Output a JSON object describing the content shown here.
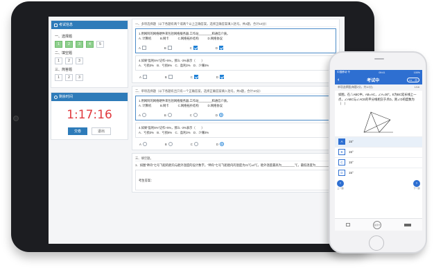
{
  "tablet": {
    "left_panel": {
      "nav_title": "考试信息",
      "sections": [
        {
          "title": "一、选择题",
          "numbers": [
            "1",
            "2",
            "3",
            "4",
            "5"
          ],
          "done": [
            true,
            true,
            true,
            true,
            false
          ]
        },
        {
          "title": "二、填空题",
          "numbers": [
            "1",
            "2",
            "3"
          ],
          "done": [
            false,
            false,
            false
          ]
        },
        {
          "title": "三、简答题",
          "numbers": [
            "1",
            "2",
            "3"
          ],
          "done": [
            false,
            false,
            false
          ]
        }
      ],
      "timer_title": "剩余时间",
      "timer": "1:17:16",
      "submit_label": "交卷",
      "exit_label": "退出"
    },
    "questions": {
      "section1_head": "一、多项选择题（以下各题有两个或两个以上正确答案，选择正确答案填入括号。共2题，合计10分）",
      "q1_text": "1.用网阿的网络硬件来包括网络服务器,工作站________和通信介质。",
      "q1_choices": "A. 计算机　　　B.网卡　　　C.网络拓扑结构　　　D.网络协议",
      "q2_text": "4.如果“盈利5%”记作+5%，那么 -3%表示（　　）",
      "q2_choices": "A．亏损3%　B．亏损8%　C．盈利2%　D．少赚3%",
      "section2_head": "二、单项选择题（以下各题有且只有一个正确答案，选择正确答案填入括号。共2题，合计10分）",
      "q3_text": "1.用网阿的网络硬件来包括网络服务器,工作站________和通信介质。",
      "q3_choices": "A. 计算机　　　B.网卡　　　C.网络拓扑结构　　　D.网络协议",
      "q4_text": "4.如果“盈利5%”记作+5%，那么 -3%表示（　　）",
      "q4_choices": "A．亏损3%　B．亏损8%　C．盈利2%　D．少赚3%",
      "section3_head": "三、填空题。",
      "q5_text": "1．如图“神舟”七号飞船的舱内与舱外温度的设计数字。“神舟”七号飞船舱内的温度为21℃±4℃，舱外温度最高为________℃，最低温度为________℃。",
      "answer_label": "考生答案：",
      "option_letters": [
        "A",
        "B",
        "C",
        "D"
      ]
    }
  },
  "phone": {
    "status_left": "中国移动 令",
    "status_time": "09:41",
    "status_right": "100%",
    "back_icon": "‹",
    "title": "考试中",
    "menu_dots": "•••",
    "info_left": "单项选择题(每题2分，共10分)",
    "info_right": "1/16",
    "question": "如图，在△ABC中，AB=AC，∠A=30°，E为BC延长线上一点，∠ABC与∠ACE的平分线相交于点D，则∠D的度数为（　）",
    "options": [
      {
        "letter": "A",
        "value": "15°",
        "selected": true
      },
      {
        "letter": "B",
        "value": "15°",
        "selected": false
      },
      {
        "letter": "C",
        "value": "15°",
        "selected": false
      },
      {
        "letter": "D",
        "value": "15°",
        "selected": false
      }
    ],
    "prev_label": "上一题",
    "next_label": "下一题",
    "tab_center": "答题卡"
  }
}
